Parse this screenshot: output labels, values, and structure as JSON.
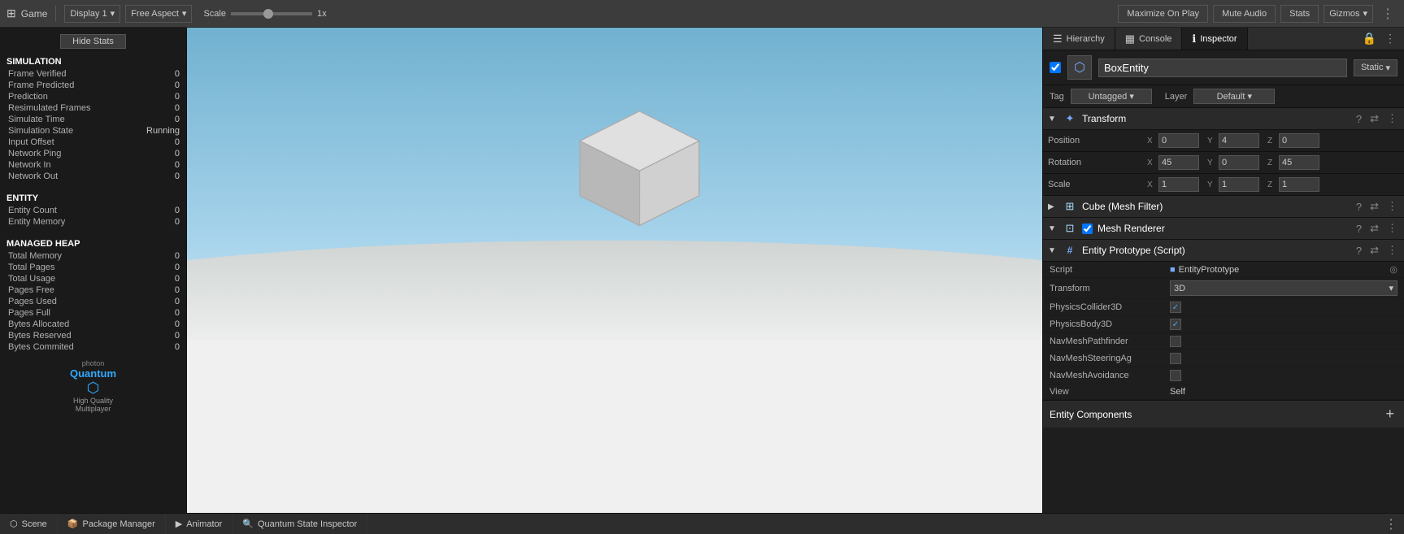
{
  "topBar": {
    "title": "Game",
    "displayLabel": "Display 1",
    "aspectLabel": "Free Aspect",
    "scaleLabel": "Scale",
    "scaleValue": "1x",
    "maximizeOnPlay": "Maximize On Play",
    "muteAudio": "Mute Audio",
    "stats": "Stats",
    "gizmos": "Gizmos"
  },
  "statsPanel": {
    "hideStats": "Hide Stats",
    "sections": {
      "simulation": {
        "header": "SIMULATION",
        "rows": [
          {
            "label": "Frame Verified",
            "value": "0"
          },
          {
            "label": "Frame Predicted",
            "value": "0"
          },
          {
            "label": "Prediction",
            "value": "0"
          },
          {
            "label": "Resimulated Frames",
            "value": "0"
          },
          {
            "label": "Simulate Time",
            "value": "0"
          },
          {
            "label": "Simulation State",
            "value": "Running"
          },
          {
            "label": "Input Offset",
            "value": "0"
          },
          {
            "label": "Network Ping",
            "value": "0"
          },
          {
            "label": "Network In",
            "value": "0"
          },
          {
            "label": "Network Out",
            "value": "0"
          }
        ]
      },
      "entity": {
        "header": "ENTITY",
        "rows": [
          {
            "label": "Entity Count",
            "value": "0"
          },
          {
            "label": "Entity Memory",
            "value": "0"
          }
        ]
      },
      "managedHeap": {
        "header": "MANAGED HEAP",
        "rows": [
          {
            "label": "Total Memory",
            "value": "0"
          },
          {
            "label": "Total Pages",
            "value": "0"
          },
          {
            "label": "Total Usage",
            "value": "0"
          },
          {
            "label": "Pages Free",
            "value": "0"
          },
          {
            "label": "Pages Used",
            "value": "0"
          },
          {
            "label": "Pages Full",
            "value": "0"
          },
          {
            "label": "Bytes Allocated",
            "value": "0"
          },
          {
            "label": "Bytes Reserved",
            "value": "0"
          },
          {
            "label": "Bytes Commited",
            "value": "0"
          }
        ]
      }
    }
  },
  "rightPanel": {
    "tabs": [
      {
        "label": "Hierarchy",
        "icon": "☰",
        "active": false
      },
      {
        "label": "Console",
        "icon": "▦",
        "active": false
      },
      {
        "label": "Inspector",
        "icon": "ℹ",
        "active": true
      }
    ],
    "entity": {
      "name": "BoxEntity",
      "staticLabel": "Static",
      "tagLabel": "Tag",
      "tagValue": "Untagged",
      "layerLabel": "Layer",
      "layerValue": "Default"
    },
    "transform": {
      "componentName": "Transform",
      "position": {
        "label": "Position",
        "x": "0",
        "y": "4",
        "z": "0"
      },
      "rotation": {
        "label": "Rotation",
        "x": "45",
        "y": "0",
        "z": "45"
      },
      "scale": {
        "label": "Scale",
        "x": "1",
        "y": "1",
        "z": "1"
      }
    },
    "meshFilter": {
      "componentName": "Cube (Mesh Filter)"
    },
    "meshRenderer": {
      "componentName": "Mesh Renderer"
    },
    "entityPrototype": {
      "componentName": "Entity Prototype (Script)",
      "scriptLabel": "Script",
      "scriptValue": "EntityPrototype",
      "transformLabel": "Transform",
      "transformValue": "3D",
      "components": [
        {
          "label": "PhysicsCollider3D",
          "checked": true
        },
        {
          "label": "PhysicsBody3D",
          "checked": true
        },
        {
          "label": "NavMeshPathfinder",
          "checked": false
        },
        {
          "label": "NavMeshSteeringAg",
          "checked": false
        },
        {
          "label": "NavMeshAvoidance",
          "checked": false
        }
      ],
      "viewLabel": "View",
      "viewValue": "Self"
    },
    "entityComponents": {
      "label": "Entity Components"
    }
  },
  "bottomTabs": [
    {
      "label": "Scene",
      "icon": "⬡",
      "active": false
    },
    {
      "label": "Package Manager",
      "icon": "📦",
      "active": false
    },
    {
      "label": "Animator",
      "icon": "▶",
      "active": false
    },
    {
      "label": "Quantum State Inspector",
      "icon": "🔍",
      "active": false
    }
  ]
}
